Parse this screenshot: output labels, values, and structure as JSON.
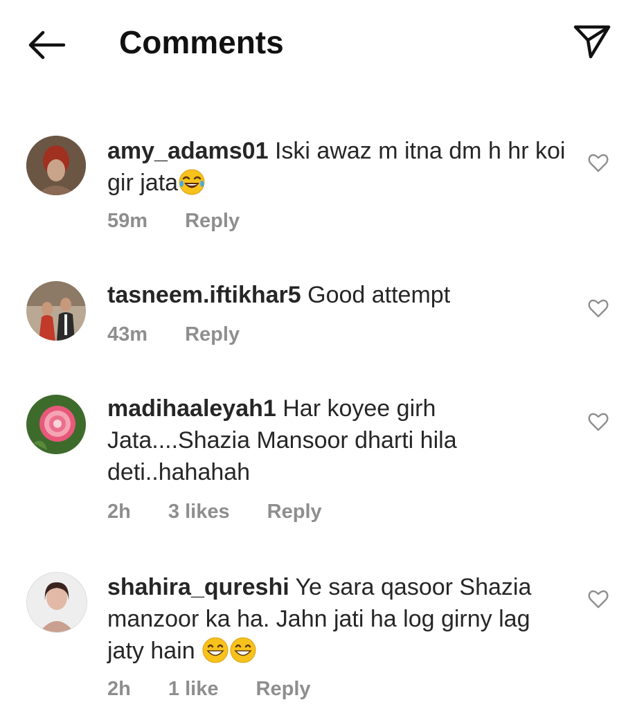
{
  "header": {
    "title": "Comments",
    "back_icon": "arrow-left-icon",
    "send_icon": "paper-plane-icon"
  },
  "comments": [
    {
      "username": "amy_adams01",
      "text": "Iski awaz m itna dm h hr koi gir jata",
      "emoji": "tears-of-joy",
      "time": "59m",
      "likes": "",
      "reply": "Reply"
    },
    {
      "username": "tasneem.iftikhar5",
      "text": "Good attempt",
      "time": "43m",
      "likes": "",
      "reply": "Reply"
    },
    {
      "username": "madihaaleyah1",
      "text": "Har koyee girh Jata....Shazia Mansoor dharti hila deti..hahahah",
      "time": "2h",
      "likes": "3 likes",
      "reply": "Reply"
    },
    {
      "username": "shahira_qureshi",
      "text": "Ye sara qasoor Shazia manzoor ka ha. Jahn jati ha log girny lag jaty hain",
      "emoji": "grinning-smile",
      "time": "2h",
      "likes": "1 like",
      "reply": "Reply"
    }
  ]
}
